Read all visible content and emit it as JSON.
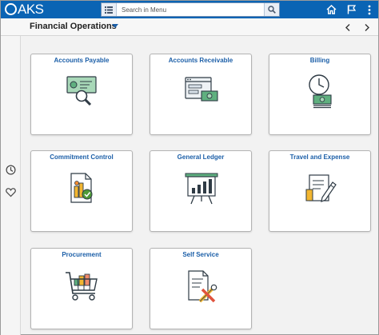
{
  "header": {
    "logo_text": "AKS",
    "search": {
      "placeholder": "Search in Menu"
    },
    "icons": [
      "menu-icon",
      "search-icon",
      "home-icon",
      "flag-icon",
      "more-options-icon"
    ]
  },
  "subheader": {
    "title": "Financial Operations"
  },
  "sidebar": {
    "icons": [
      "recent-history-icon",
      "favorites-icon"
    ]
  },
  "tiles": [
    {
      "label": "Accounts Payable",
      "icon": "check-magnifier-icon"
    },
    {
      "label": "Accounts Receivable",
      "icon": "browser-money-icon"
    },
    {
      "label": "Billing",
      "icon": "clock-money-icon"
    },
    {
      "label": "Commitment Control",
      "icon": "document-chart-icon"
    },
    {
      "label": "General Ledger",
      "icon": "presentation-board-icon"
    },
    {
      "label": "Travel and Expense",
      "icon": "form-pencil-icon"
    },
    {
      "label": "Procurement",
      "icon": "shopping-cart-icon"
    },
    {
      "label": "Self Service",
      "icon": "document-tools-icon"
    }
  ],
  "colors": {
    "header_bg": "#0a64b4",
    "tile_title": "#1c5fa8",
    "page_bg": "#f2f2f2"
  }
}
